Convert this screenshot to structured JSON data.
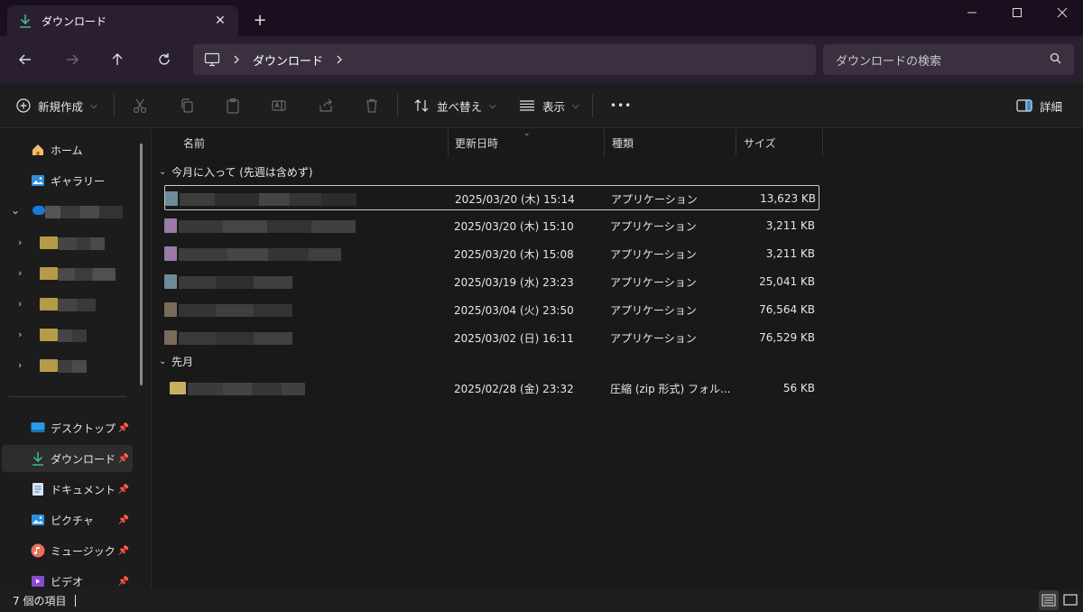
{
  "titlebar": {
    "tab_label": "ダウンロード",
    "tab_close": "✕",
    "new_tab": "+"
  },
  "nav": {
    "address_segments": [
      "ダウンロード"
    ],
    "search_placeholder": "ダウンロードの検索"
  },
  "commands": {
    "new_label": "新規作成",
    "sort_label": "並べ替え",
    "view_label": "表示",
    "more_label": "•••",
    "details_label": "詳細"
  },
  "sidebar": {
    "home": "ホーム",
    "gallery": "ギャラリー",
    "desktop": "デスクトップ",
    "downloads": "ダウンロード",
    "documents": "ドキュメント",
    "pictures": "ピクチャ",
    "music": "ミュージック",
    "videos": "ビデオ"
  },
  "columns": {
    "name": "名前",
    "date": "更新日時",
    "type": "種類",
    "size": "サイズ"
  },
  "groups": [
    {
      "label": "今月に入って (先週は含めず)",
      "files": [
        {
          "date": "2025/03/20 (木) 15:14",
          "type": "アプリケーション",
          "size": "13,623 KB"
        },
        {
          "date": "2025/03/20 (木) 15:10",
          "type": "アプリケーション",
          "size": "3,211 KB"
        },
        {
          "date": "2025/03/20 (木) 15:08",
          "type": "アプリケーション",
          "size": "3,211 KB"
        },
        {
          "date": "2025/03/19 (水) 23:23",
          "type": "アプリケーション",
          "size": "25,041 KB"
        },
        {
          "date": "2025/03/04 (火) 23:50",
          "type": "アプリケーション",
          "size": "76,564 KB"
        },
        {
          "date": "2025/03/02 (日) 16:11",
          "type": "アプリケーション",
          "size": "76,529 KB"
        }
      ]
    },
    {
      "label": "先月",
      "files": [
        {
          "date": "2025/02/28 (金) 23:32",
          "type": "圧縮 (zip 形式) フォル...",
          "size": "56 KB"
        }
      ]
    }
  ],
  "status": {
    "item_count": "7 個の項目"
  },
  "colors": {
    "accent_green": "#3fb68b",
    "titlebar_bg": "#1a0f1f",
    "nav_bg": "#2a1f30"
  }
}
